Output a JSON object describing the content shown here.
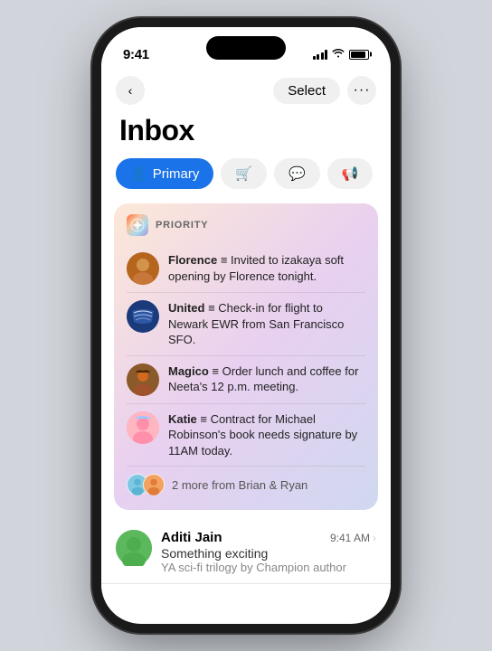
{
  "statusBar": {
    "time": "9:41",
    "signalBars": [
      3,
      6,
      9,
      11,
      11
    ],
    "wifi": "wifi",
    "battery": "battery"
  },
  "nav": {
    "backLabel": "‹",
    "selectLabel": "Select",
    "moreLabel": "···"
  },
  "page": {
    "title": "Inbox"
  },
  "tabs": [
    {
      "id": "primary",
      "label": "Primary",
      "icon": "👤",
      "active": true
    },
    {
      "id": "shopping",
      "label": "",
      "icon": "🛒",
      "active": false
    },
    {
      "id": "chat",
      "label": "",
      "icon": "💬",
      "active": false
    },
    {
      "id": "updates",
      "label": "",
      "icon": "📢",
      "active": false
    }
  ],
  "priorityCard": {
    "label": "PRIORITY",
    "iconEmoji": "✦",
    "emails": [
      {
        "id": "florence",
        "sender": "Florence",
        "clip": "≡",
        "preview": "Invited to izakaya soft opening by Florence tonight.",
        "avatarEmoji": "👩"
      },
      {
        "id": "united",
        "sender": "United",
        "clip": "≡",
        "preview": "Check-in for flight to Newark EWR from San Francisco SFO.",
        "avatarEmoji": "✈"
      },
      {
        "id": "magico",
        "sender": "Magico",
        "clip": "≡",
        "preview": "Order lunch and coffee for Neeta's 12 p.m. meeting.",
        "avatarEmoji": "🤠"
      },
      {
        "id": "katie",
        "sender": "Katie",
        "clip": "≡",
        "preview": "Contract for Michael Robinson's book needs signature by 11AM today.",
        "avatarEmoji": "🎀"
      }
    ],
    "moreText": "2 more from Brian & Ryan",
    "moreAvatars": [
      "🧑",
      "👨"
    ]
  },
  "emailList": [
    {
      "id": "aditi",
      "name": "Aditi Jain",
      "time": "9:41 AM",
      "subject": "Something exciting",
      "preview": "YA sci-fi trilogy by Champion author",
      "avatarEmoji": "👩",
      "avatarBg": "#6ab04c"
    }
  ]
}
